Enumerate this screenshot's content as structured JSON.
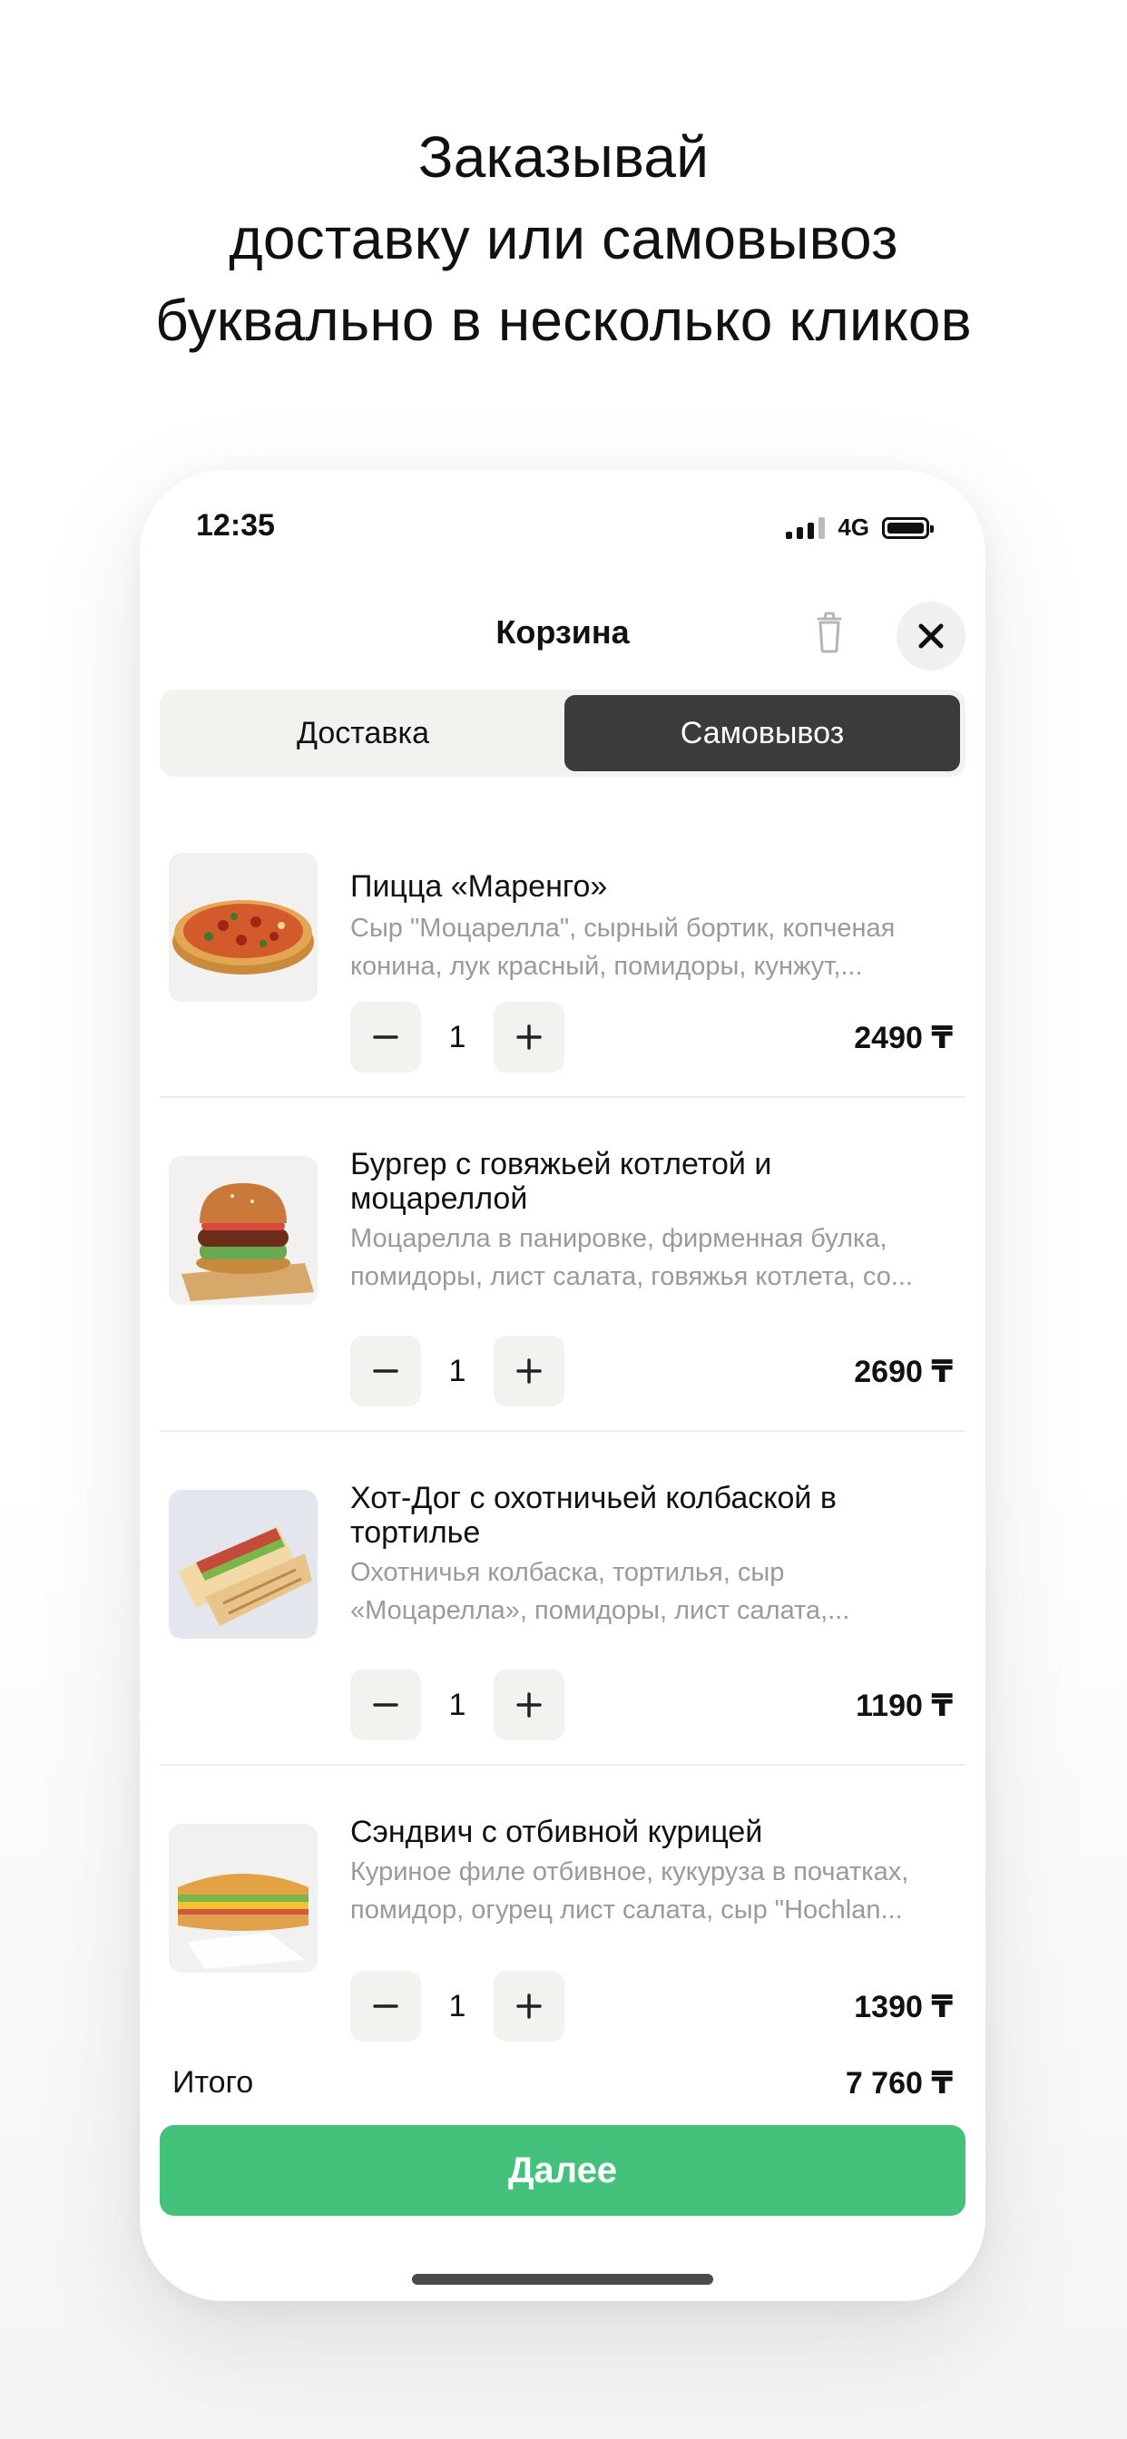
{
  "headline": {
    "line1": "Заказывай",
    "line2": "доставку или самовывоз",
    "line3": "буквально в несколько кликов"
  },
  "status_bar": {
    "time": "12:35",
    "network": "4G"
  },
  "cart": {
    "title": "Корзина",
    "tabs": [
      "Доставка",
      "Самовывоз"
    ],
    "selected_tab": "Самовывоз",
    "items": [
      {
        "title": "Пицца «Маренго»",
        "description": "Сыр \"Моцарелла\", сырный бортик, копченая конина, лук красный, помидоры, кунжут,...",
        "quantity": "1",
        "price": "2490 ₸",
        "image_icon": "pizza-image"
      },
      {
        "title": "Бургер с говяжьей котлетой и моцареллой",
        "description": "Моцарелла в панировке, фирменная булка, помидоры, лист салата, говяжья котлета, со...",
        "quantity": "1",
        "price": "2690 ₸",
        "image_icon": "burger-image"
      },
      {
        "title": "Хот-Дог с охотничьей колбаской в тортилье",
        "description": "Охотничья колбаска, тортилья, сыр «Моцарелла», помидоры, лист салата,...",
        "quantity": "1",
        "price": "1190 ₸",
        "image_icon": "wrap-image"
      },
      {
        "title": "Сэндвич с отбивной курицей",
        "description": "Куриное филе отбивное, кукуруза в початках, помидор, огурец лист салата, сыр \"Hochlan...",
        "quantity": "1",
        "price": "1390 ₸",
        "image_icon": "sandwich-image"
      }
    ],
    "total_label": "Итого",
    "total_value": "7 760 ₸",
    "next_button": "Далее"
  },
  "colors": {
    "accent_green": "#44c17b",
    "segment_selected": "#3b3b3b",
    "segment_bg": "#f3f2ee",
    "muted_text": "#9a9a9a"
  }
}
